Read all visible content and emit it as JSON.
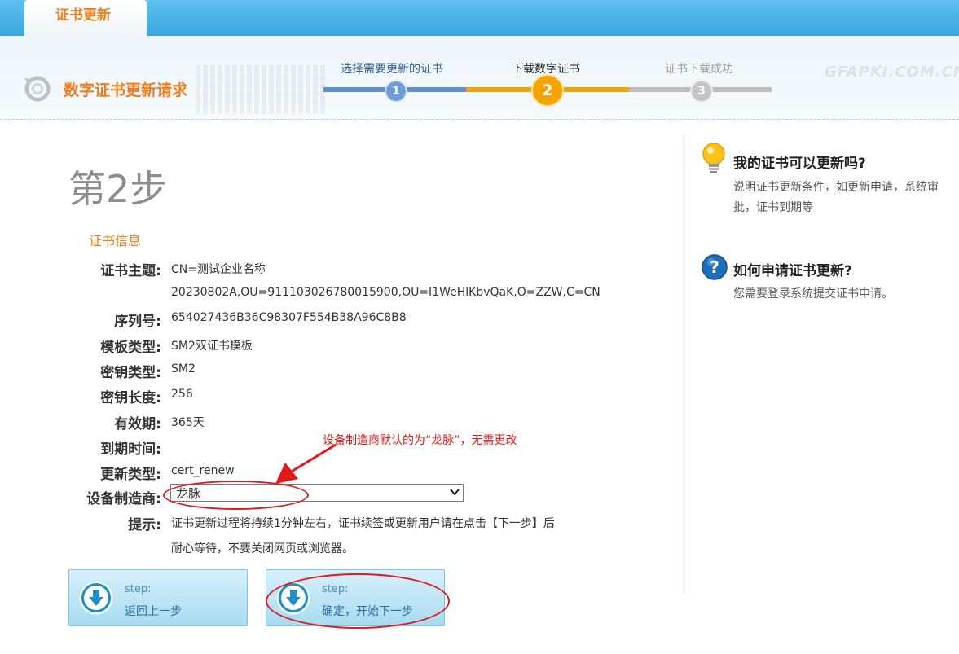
{
  "tab": {
    "label": "证书更新"
  },
  "header": {
    "title": "数字证书更新请求",
    "watermark": "GFAPKI.COM.CN"
  },
  "stepper": [
    {
      "label": "选择需要更新的证书",
      "number": "1",
      "state": "done"
    },
    {
      "label": "下载数字证书",
      "number": "2",
      "state": "current"
    },
    {
      "label": "证书下载成功",
      "number": "3",
      "state": "pending"
    }
  ],
  "main": {
    "step_heading": "第2步",
    "section_label": "证书信息",
    "fields": [
      {
        "label": "证书主题:",
        "value": "CN=测试企业名称"
      },
      {
        "label": "",
        "value": "20230802A,OU=911103026780015900,OU=I1WeHlKbvQaK,O=ZZW,C=CN"
      },
      {
        "label": "序列号:",
        "value": "654027436B36C98307F554B38A96C8B8"
      },
      {
        "label": "模板类型:",
        "value": "SM2双证书模板"
      },
      {
        "label": "密钥类型:",
        "value": "SM2"
      },
      {
        "label": "密钥长度:",
        "value": "256"
      },
      {
        "label": "有效期:",
        "value": "365天"
      },
      {
        "label": "到期时间:",
        "value": ""
      },
      {
        "label": "更新类型:",
        "value": "cert_renew"
      }
    ],
    "manufacturer": {
      "label": "设备制造商:",
      "selected": "龙脉"
    },
    "tip": {
      "label": "提示:",
      "line1": "证书更新过程将持续1分钟左右，证书续签或更新用户请在点击【下一步】后",
      "line2": "耐心等待，不要关闭网页或浏览器。"
    },
    "annotation": "设备制造商默认的为“龙脉”，无需更改",
    "buttons": {
      "back": {
        "step": "step:",
        "label": "返回上一步"
      },
      "next": {
        "step": "step:",
        "label": "确定，开始下一步"
      }
    }
  },
  "sidebar": {
    "faq": [
      {
        "icon": "lightbulb-icon",
        "title": "我的证书可以更新吗?",
        "body": "说明证书更新条件，如更新申请，系统审批，证书到期等"
      },
      {
        "icon": "question-icon",
        "title": "如何申请证书更新?",
        "body": "您需要登录系统提交证书申请。"
      }
    ]
  },
  "colors": {
    "accent_orange": "#ef7d1b",
    "step_done": "#5b8fd6",
    "step_current": "#f5a300",
    "step_pending": "#bdbdbd",
    "annotation_red": "#e0191b",
    "topbar_blue": "#3aa6e0"
  }
}
